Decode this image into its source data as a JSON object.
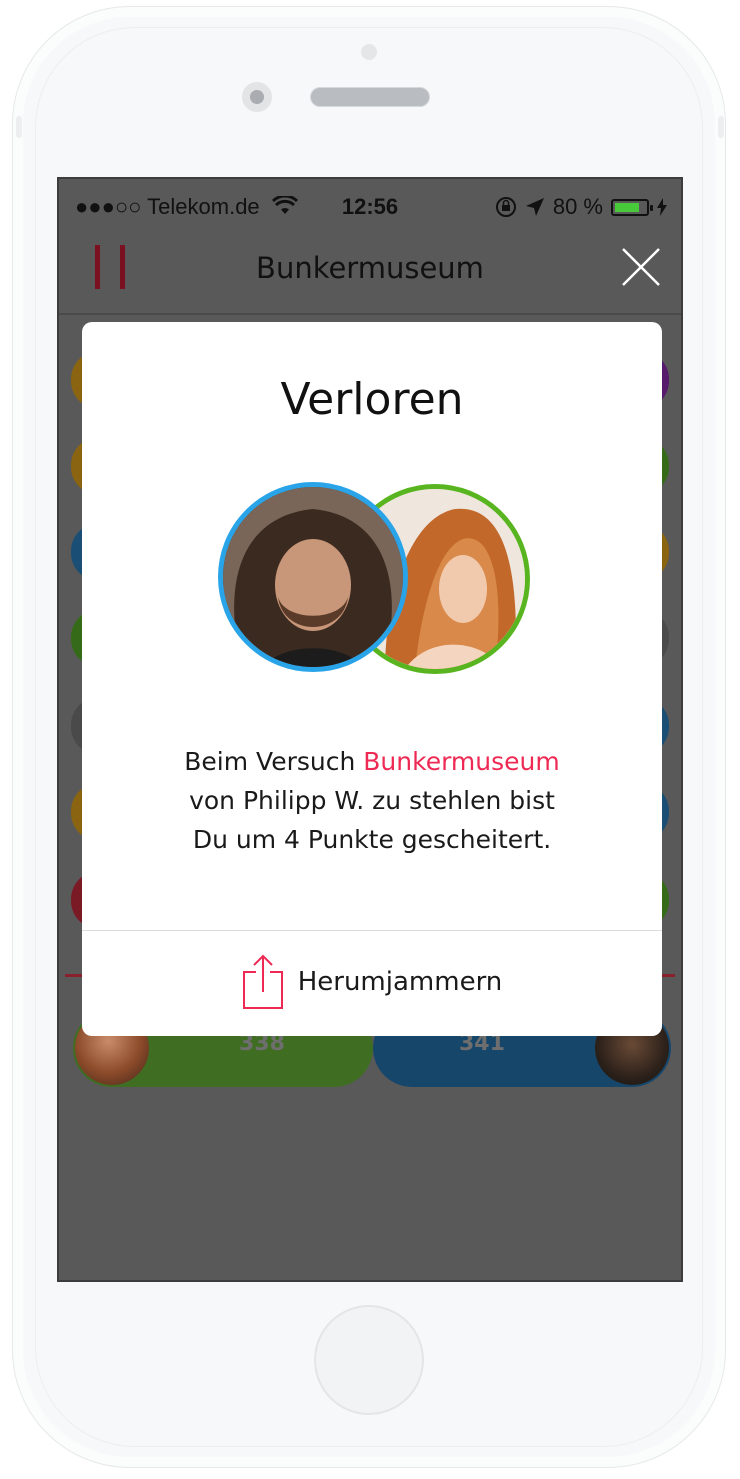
{
  "status_bar": {
    "carrier": "●●●○○ Telekom.de",
    "time": "12:56",
    "battery_pct": "80 %"
  },
  "nav": {
    "title": "Bunkermuseum"
  },
  "scores": {
    "left": "338",
    "right": "341"
  },
  "modal": {
    "title": "Verloren",
    "line1_prefix": "Beim Versuch ",
    "line1_highlight": "Bunkermuseum",
    "line2": "von Philipp W. zu stehlen bist",
    "line3": "Du um 4 Punkte gescheitert.",
    "action_label": "Herumjammern"
  },
  "colors": {
    "accent": "#ee2a54",
    "player_blue": "#2aa4e8",
    "player_green": "#58b51f"
  }
}
